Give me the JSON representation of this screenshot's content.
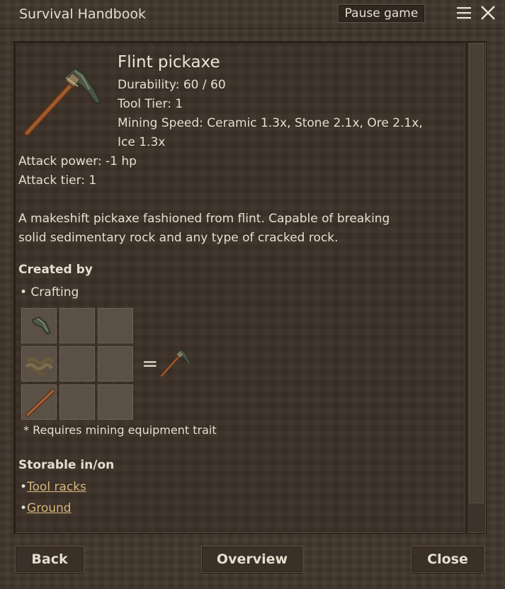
{
  "window": {
    "title": "Survival Handbook",
    "pause_label": "Pause game"
  },
  "item": {
    "name": "Flint pickaxe",
    "icon": "flint-pickaxe-icon",
    "durability": "Durability: 60 / 60",
    "tool_tier": "Tool Tier: 1",
    "mining_speed_line1": "Mining Speed: Ceramic 1.3x, Stone 2.1x, Ore 2.1x,",
    "mining_speed_line2": "Ice 1.3x",
    "attack_power": "Attack power: -1 hp",
    "attack_tier": "Attack tier: 1",
    "description_line1": "A makeshift pickaxe fashioned from flint. Capable of breaking",
    "description_line2": "solid sedimentary rock and any type of cracked rock."
  },
  "created_by": {
    "heading": "Created by",
    "method": "• Crafting",
    "grid": [
      [
        "flint-icon",
        "",
        ""
      ],
      [
        "rope-icon",
        "",
        ""
      ],
      [
        "stick-icon",
        "",
        ""
      ]
    ],
    "equals": "=",
    "result_icon": "flint-pickaxe-icon",
    "note": "* Requires mining equipment trait"
  },
  "storable": {
    "heading": "Storable in/on",
    "items": [
      {
        "bullet": "•",
        "label": "Tool racks"
      },
      {
        "bullet": "•",
        "label": "Ground"
      }
    ]
  },
  "footer": {
    "back": "Back",
    "overview": "Overview",
    "close": "Close"
  }
}
